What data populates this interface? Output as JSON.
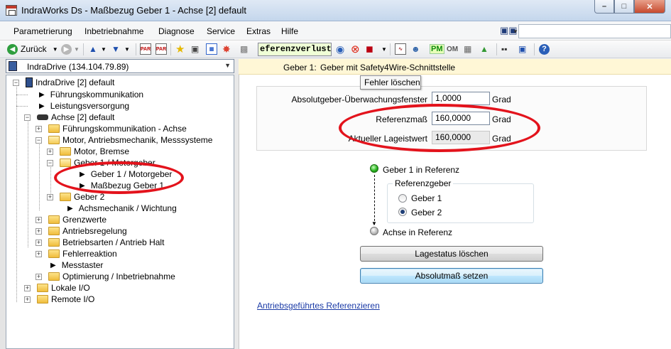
{
  "window": {
    "title": "IndraWorks Ds - Maßbezug Geber 1 - Achse [2] default",
    "minimize": "–",
    "maximize": "□",
    "close": "✕"
  },
  "menu": {
    "items": [
      "Parametrierung",
      "Inbetriebnahme",
      "Diagnose",
      "Service",
      "Extras",
      "Hilfe"
    ],
    "search_value": ""
  },
  "toolbar": {
    "back_label": "Zurück",
    "status_field": "eferenzverlust",
    "pm_label": "PM",
    "om_label": "OM",
    "help": "?"
  },
  "device_selector": {
    "value": "IndraDrive (134.104.79.89)"
  },
  "tree": {
    "root": "IndraDrive [2] default",
    "items": [
      "Führungskommunikation",
      "Leistungsversorgung",
      "Achse [2] default",
      "Führungskommunikation - Achse",
      "Motor, Antriebsmechanik, Messsysteme",
      "Motor, Bremse",
      "Geber 1 / Motorgeber",
      "Geber 1 / Motorgeber",
      "Maßbezug Geber 1",
      "Geber 2",
      "Achsmechanik / Wichtung",
      "Grenzwerte",
      "Antriebsregelung",
      "Betriebsarten / Antrieb Halt",
      "Fehlerreaktion",
      "Messtaster",
      "Optimierung / Inbetriebnahme",
      "Lokale I/O",
      "Remote I/O"
    ]
  },
  "encoder": {
    "header_label": "Geber 1:",
    "header_text": "Geber mit Safety4Wire-Schnittstelle",
    "tooltip": "Fehler löschen",
    "params": [
      {
        "label": "Absolutgeber-Überwachungsfenster",
        "value": "1,0000",
        "unit": "Grad"
      },
      {
        "label": "Referenzmaß",
        "value": "160,0000",
        "unit": "Grad"
      },
      {
        "label": "Aktueller Lageistwert",
        "value": "160,0000",
        "unit": "Grad"
      }
    ],
    "in_reference_label": "Geber 1 in Referenz",
    "reference_group_title": "Referenzgeber",
    "radio_options": [
      "Geber 1",
      "Geber 2"
    ],
    "selected_radio": "Geber 2",
    "axis_reference_label": "Achse in Referenz",
    "button_clear_position": "Lagestatus löschen",
    "button_set_absolute": "Absolutmaß setzen",
    "link_drive_referencing": "Antriebsgeführtes Referenzieren"
  },
  "colors": {
    "highlight_ellipse": "#e3131c",
    "led_green": "#29b31f",
    "link": "#1a3aa6"
  }
}
